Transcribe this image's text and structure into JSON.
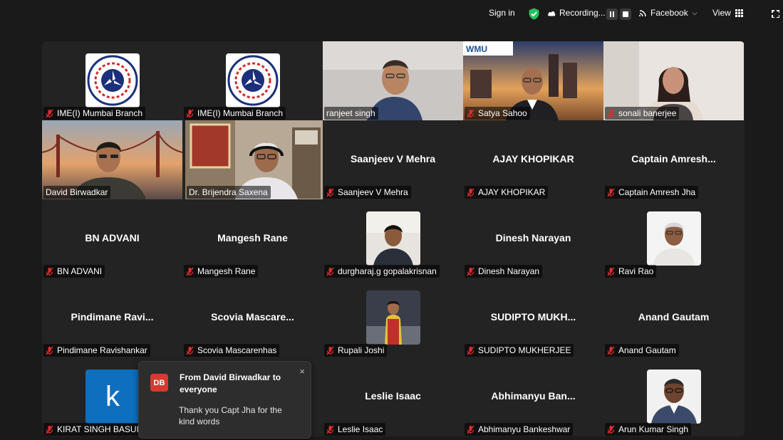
{
  "topbar": {
    "sign_in": "Sign in",
    "recording": "Recording...",
    "live_target": "Facebook",
    "view": "View"
  },
  "colors": {
    "active_speaker": "#25c274",
    "muted_mic": "#e02d2d",
    "toast_avatar": "#d63b2f"
  },
  "tiles": [
    {
      "label": "IME(I) Mumbai Branch"
    },
    {
      "label": "IME(I) Mumbai Branch"
    },
    {
      "label": "ranjeet singh"
    },
    {
      "label": "Satya Sahoo",
      "logo_text": "WMU"
    },
    {
      "label": "sonali banerjee"
    },
    {
      "label": "David Birwadkar"
    },
    {
      "label": "Dr. Brijendra Saxena"
    },
    {
      "display_name": "Saanjeev V Mehra",
      "label": "Saanjeev V Mehra"
    },
    {
      "display_name": "AJAY KHOPIKAR",
      "label": "AJAY KHOPIKAR"
    },
    {
      "display_name": "Captain  Amresh...",
      "label": "Captain Amresh Jha"
    },
    {
      "display_name": "BN ADVANI",
      "label": "BN ADVANI"
    },
    {
      "display_name": "Mangesh Rane",
      "label": "Mangesh Rane"
    },
    {
      "label": "durgharaj.g gopalakrisnan"
    },
    {
      "display_name": "Dinesh Narayan",
      "label": "Dinesh Narayan"
    },
    {
      "label": "Ravi Rao"
    },
    {
      "display_name": "Pindimane  Ravi...",
      "label": "Pindimane Ravishankar"
    },
    {
      "display_name": "Scovia  Mascare...",
      "label": "Scovia Mascarenhas"
    },
    {
      "label": "Rupali Joshi"
    },
    {
      "display_name": "SUDIPTO  MUKH...",
      "label": "SUDIPTO MUKHERJEE"
    },
    {
      "display_name": "Anand Gautam",
      "label": "Anand Gautam"
    },
    {
      "label": "KIRAT SINGH BASUR",
      "avatar_letter": "k"
    },
    {
      "label": ""
    },
    {
      "display_name": "Leslie Isaac",
      "label": "Leslie Isaac"
    },
    {
      "display_name": "Abhimanyu  Ban...",
      "label": "Abhimanyu Bankeshwar"
    },
    {
      "label": "Arun Kumar Singh"
    }
  ],
  "toast": {
    "initials": "DB",
    "from": "From David Birwadkar to everyone",
    "message": "Thank you Capt Jha for the kind words",
    "close": "×"
  }
}
